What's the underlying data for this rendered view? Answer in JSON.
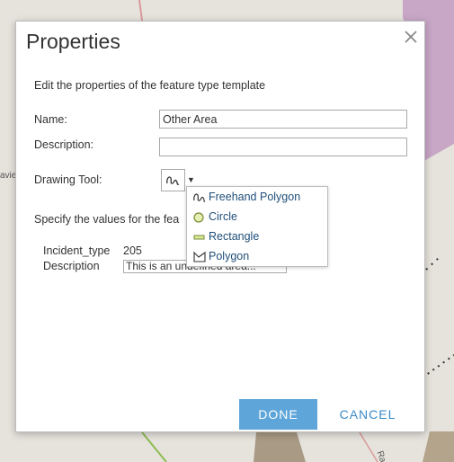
{
  "map": {
    "edge_label_left": "avie",
    "edge_label_bottom": "Ra"
  },
  "dialog": {
    "title": "Properties",
    "close_icon": "close-icon",
    "intro": "Edit the properties of the feature type template",
    "name_label": "Name:",
    "name_value": "Other Area",
    "description_label": "Description:",
    "description_value": "",
    "drawing_tool_label": "Drawing Tool:",
    "drawing_tool_selected_icon": "freehand-polygon-icon",
    "specify_text": "Specify the values for the fea",
    "attributes": [
      {
        "label": "Incident_type",
        "value": "205"
      },
      {
        "label": "Description",
        "value": "This is an undefined area..."
      }
    ],
    "tool_menu": [
      {
        "label": "Freehand Polygon",
        "icon": "freehand-polygon-icon"
      },
      {
        "label": "Circle",
        "icon": "circle-icon"
      },
      {
        "label": "Rectangle",
        "icon": "rectangle-icon"
      },
      {
        "label": "Polygon",
        "icon": "polygon-icon"
      }
    ],
    "done_label": "DONE",
    "cancel_label": "CANCEL"
  },
  "colors": {
    "primary_button": "#5ea6d9",
    "link_blue": "#3a8ac8",
    "menu_text": "#1f4e79",
    "map_purple": "#c8a6c6",
    "map_brown": "#b5a48c"
  }
}
